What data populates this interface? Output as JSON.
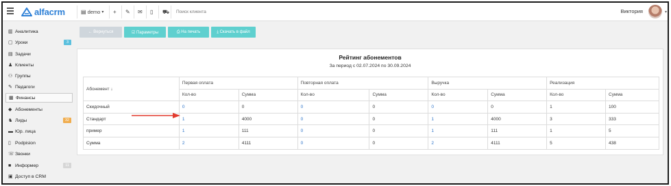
{
  "topbar": {
    "logo_text": "alfacrm",
    "branch": "demo",
    "branch_caret": "▾",
    "icons": [
      "plus-icon",
      "pin-icon",
      "mail-icon",
      "phone-icon",
      "cart-icon"
    ],
    "search_placeholder": "Поиск клиента",
    "user_name": "Виктория",
    "user_caret": "▾"
  },
  "sidebar": {
    "items": [
      {
        "label": "Аналитика",
        "icon": "▥",
        "icon_name": "analytics-icon"
      },
      {
        "label": "Уроки",
        "icon": "▢",
        "icon_name": "calendar-icon",
        "badge": "3",
        "badge_color": "#5bc0de"
      },
      {
        "label": "Задачи",
        "icon": "▤",
        "icon_name": "tasks-icon"
      },
      {
        "label": "Клиенты",
        "icon": "♟",
        "icon_name": "client-icon"
      },
      {
        "label": "Группы",
        "icon": "⚇",
        "icon_name": "groups-icon"
      },
      {
        "label": "Педагоги",
        "icon": "✎",
        "icon_name": "teacher-icon"
      },
      {
        "label": "Финансы",
        "icon": "▦",
        "icon_name": "finance-icon",
        "active": true
      },
      {
        "label": "Абонементы",
        "icon": "◆",
        "icon_name": "subscription-icon"
      },
      {
        "label": "Лиды",
        "icon": "♞",
        "icon_name": "leads-icon",
        "badge": "32",
        "badge_color": "#f0ad4e"
      },
      {
        "label": "Юр. лица",
        "icon": "▬",
        "icon_name": "legal-entity-icon"
      },
      {
        "label": "Podpisіon",
        "icon": "▯",
        "icon_name": "document-icon"
      },
      {
        "label": "Звонки",
        "icon": "☏",
        "icon_name": "phone-icon"
      },
      {
        "label": "Информер",
        "icon": "■",
        "icon_name": "informer-icon",
        "badge": "11",
        "badge_color": "#d6d6d6"
      },
      {
        "label": "Доступ в CRM",
        "icon": "▣",
        "icon_name": "lock-icon"
      }
    ]
  },
  "actions": {
    "back": "← Вернуться",
    "params": "☑ Параметры",
    "print": "⎙ На печать",
    "download": "⤓ Скачать в файл"
  },
  "report": {
    "title": "Рейтинг абонементов",
    "subtitle": "За период с 02.07.2024 по 30.09.2024",
    "col_subscription": "Абонемент ↓",
    "groups": [
      "Первая оплата",
      "Повторная оплата",
      "Выручка",
      "Реализация"
    ],
    "subcols": [
      "Кол-во",
      "Сумма"
    ],
    "rows": [
      {
        "name": "Скидочный",
        "cells": [
          "0",
          "0",
          "0",
          "0",
          "0",
          "0",
          "1",
          "100"
        ]
      },
      {
        "name": "Стандарт",
        "cells": [
          "1",
          "4000",
          "0",
          "0",
          "1",
          "4000",
          "3",
          "333"
        ]
      },
      {
        "name": "пример",
        "cells": [
          "1",
          "111",
          "0",
          "0",
          "1",
          "111",
          "1",
          "5"
        ]
      },
      {
        "name": "Сумма",
        "cells": [
          "2",
          "4111",
          "0",
          "0",
          "2",
          "4111",
          "5",
          "438"
        ]
      }
    ]
  },
  "colors": {
    "accent": "#2c7fd6",
    "button_gray": "#cfd6dc",
    "button_teal": "#5fd0cf",
    "link": "#2a72c8",
    "arrow": "#e23b2e"
  }
}
